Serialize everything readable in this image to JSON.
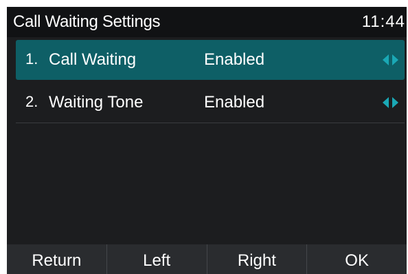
{
  "header": {
    "title": "Call Waiting Settings",
    "time": "11:44"
  },
  "items": [
    {
      "index": "1.",
      "label": "Call Waiting",
      "value": "Enabled",
      "selected": true
    },
    {
      "index": "2.",
      "label": "Waiting Tone",
      "value": "Enabled",
      "selected": false
    }
  ],
  "softkeys": [
    "Return",
    "Left",
    "Right",
    "OK"
  ],
  "colors": {
    "highlight": "#0e5f66",
    "arrow": "#1aa8b5",
    "background": "#1c1d1f"
  }
}
